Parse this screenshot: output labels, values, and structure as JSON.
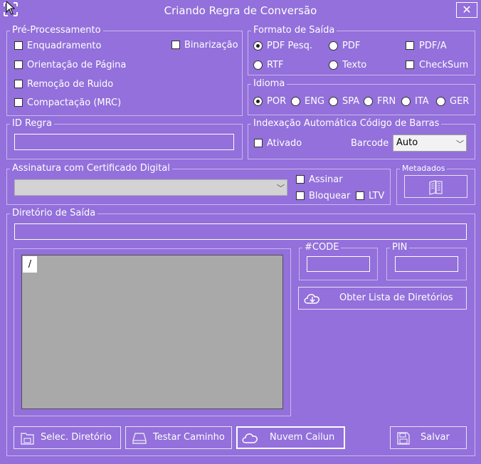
{
  "window": {
    "title": "Criando Regra de Conversão",
    "close_glyph": "✕",
    "background": "#9370DB"
  },
  "preprocessamento": {
    "legend": "Pré-Processamento",
    "enquadramento": "Enquadramento",
    "orientacao": "Orientação de Página",
    "remocao": "Remoção de Ruido",
    "compactacao": "Compactação (MRC)",
    "binarizacao": "Binarização"
  },
  "formato": {
    "legend": "Formato de Saída",
    "pdf_pesq": "PDF Pesq.",
    "pdf": "PDF",
    "pdfa": "PDF/A",
    "rtf": "RTF",
    "texto": "Texto",
    "checksum": "CheckSum",
    "selected": "PDF Pesq."
  },
  "idioma": {
    "legend": "Idioma",
    "options": [
      "POR",
      "ENG",
      "SPA",
      "FRN",
      "ITA",
      "GER"
    ],
    "selected": "POR"
  },
  "id_regra": {
    "legend": "ID Regra",
    "value": ""
  },
  "indexacao": {
    "legend": "Indexação Automática Código de Barras",
    "ativado": "Ativado",
    "barcode_label": "Barcode",
    "barcode_value": "Auto"
  },
  "assinatura": {
    "legend": "Assinatura com Certificado Digital",
    "certificate_value": "",
    "assinar": "Assinar",
    "bloquear": "Bloquear",
    "ltv": "LTV"
  },
  "metadados": {
    "legend": "Metadados",
    "icon": "book-icon"
  },
  "diretorio": {
    "legend": "Diretório de Saída",
    "path_value": "",
    "tree_root": "/",
    "code_legend": "#CODE",
    "code_value": "",
    "pin_legend": "PIN",
    "pin_value": "",
    "obter_label": "Obter Lista de Diretórios"
  },
  "buttons": {
    "selec": "Selec. Diretório",
    "testar": "Testar Caminho",
    "nuvem": "Nuvem Cailun",
    "salvar": "Salvar"
  }
}
